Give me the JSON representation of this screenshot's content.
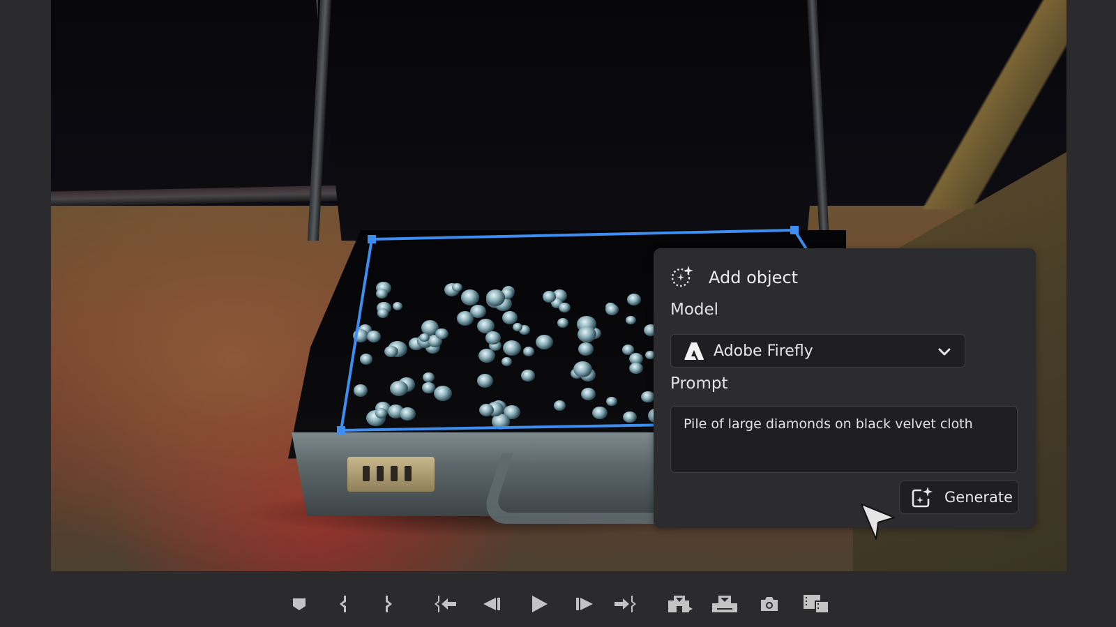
{
  "panel": {
    "title": "Add object",
    "title_icon": "generative-fill-sparkle-icon",
    "model_label": "Model",
    "model_selected": "Adobe Firefly",
    "model_icon": "adobe-firefly-logo-icon",
    "prompt_label": "Prompt",
    "prompt_value": "Pile of large diamonds on black velvet cloth",
    "generate_label": "Generate",
    "generate_icon": "generate-sparkle-icon"
  },
  "colors": {
    "selection": "#3d8ef0",
    "panel_bg": "#2c2b2d",
    "field_bg": "#1f1e20",
    "app_bg": "#2b2a2c"
  },
  "transport": [
    {
      "name": "add-marker",
      "icon": "marker-icon"
    },
    {
      "name": "mark-in",
      "icon": "mark-in-icon"
    },
    {
      "name": "mark-out",
      "icon": "mark-out-icon"
    },
    {
      "name": "go-to-in",
      "icon": "go-to-in-icon"
    },
    {
      "name": "step-back",
      "icon": "step-back-icon"
    },
    {
      "name": "play",
      "icon": "play-icon"
    },
    {
      "name": "step-forward",
      "icon": "step-forward-icon"
    },
    {
      "name": "go-to-out",
      "icon": "go-to-out-icon"
    },
    {
      "name": "insert",
      "icon": "insert-icon"
    },
    {
      "name": "overwrite",
      "icon": "overwrite-icon"
    },
    {
      "name": "export-frame",
      "icon": "camera-icon"
    },
    {
      "name": "comparison-view",
      "icon": "comparison-view-icon"
    }
  ]
}
